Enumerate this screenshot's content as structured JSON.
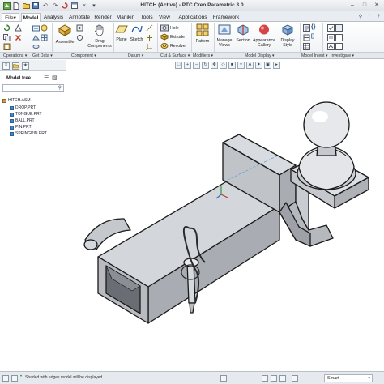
{
  "window": {
    "title": "HITCH (Active) - PTC Creo Parametric 3.0",
    "controls": [
      "–",
      "□",
      "✕"
    ]
  },
  "tabs": [
    {
      "label": "File",
      "dropdown": "▾"
    },
    {
      "label": "Model"
    },
    {
      "label": "Analysis"
    },
    {
      "label": "Annotate"
    },
    {
      "label": "Render"
    },
    {
      "label": "Manikin"
    },
    {
      "label": "Tools"
    },
    {
      "label": "View"
    },
    {
      "label": "Applications"
    },
    {
      "label": "Framework"
    }
  ],
  "ribbon": {
    "tools": {
      "assemble": "Assemble",
      "drag_components": "Drag\nComponents",
      "plane": "Plane",
      "sketch": "Sketch",
      "hole": "Hole",
      "extrude": "Extrude",
      "revolve": "Revolve",
      "pattern": "Pattern",
      "manage_views": "Manage\nViews",
      "section": "Section",
      "appearance_gallery": "Appearance\nGallery",
      "display_style": "Display\nStyle"
    },
    "groups": [
      "Operations ▾",
      "Get Data ▾",
      "Component ▾",
      "Datum ▾",
      "Cut & Surface ▾",
      "Modifiers ▾",
      "Model Display ▾",
      "Model Intent ▾",
      "Investigate ▾"
    ]
  },
  "model_tree": {
    "title": "Model tree",
    "items": [
      {
        "label": "HITCH.ASM",
        "type": "assembly"
      },
      {
        "label": "DROP.PRT",
        "type": "part"
      },
      {
        "label": "TONGUE.PRT",
        "type": "part"
      },
      {
        "label": "BALL.PRT",
        "type": "part"
      },
      {
        "label": "PIN.PRT",
        "type": "part"
      },
      {
        "label": "SPRINGPIN.PRT",
        "type": "part"
      }
    ]
  },
  "status": {
    "message": "Shaded with edges model will be displayed",
    "filter": "Smart"
  },
  "colors": {
    "model_fill": "#bfc3c8",
    "model_edge": "#1a1a1a",
    "ribbon_bg": "#eef1f4"
  }
}
